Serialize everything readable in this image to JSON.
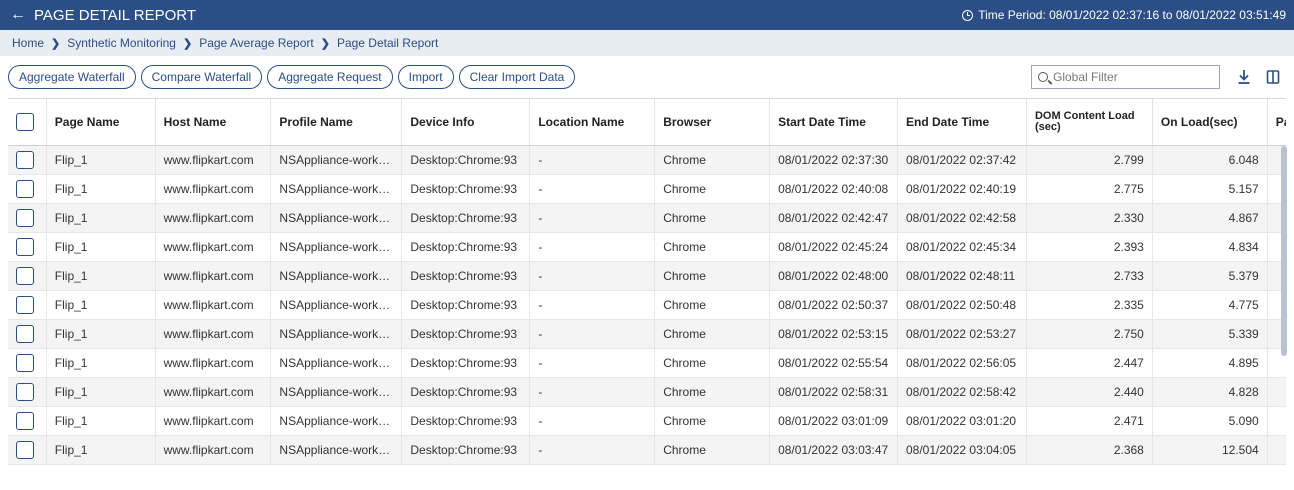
{
  "header": {
    "back_icon": "arrow-left-icon",
    "title": "PAGE DETAIL REPORT",
    "time_icon": "clock-icon",
    "time_period": "Time Period: 08/01/2022 02:37:16 to 08/01/2022 03:51:49"
  },
  "breadcrumb": [
    "Home",
    "Synthetic Monitoring",
    "Page Average Report",
    "Page Detail Report"
  ],
  "toolbar": {
    "buttons": [
      "Aggregate Waterfall",
      "Compare Waterfall",
      "Aggregate Request",
      "Import",
      "Clear Import Data"
    ],
    "filter_placeholder": "Global Filter",
    "download_icon": "download-icon",
    "columns_icon": "columns-icon"
  },
  "table": {
    "columns": [
      "Page Name",
      "Host Name",
      "Profile Name",
      "Device Info",
      "Location Name",
      "Browser",
      "Start Date Time",
      "End Date Time",
      "DOM Content Load (sec)",
      "On Load(sec)",
      "Pag"
    ],
    "rows": [
      [
        "Flip_1",
        "www.flipkart.com",
        "NSAppliance-work-c...",
        "Desktop:Chrome:93",
        "-",
        "Chrome",
        "08/01/2022 02:37:30",
        "08/01/2022 02:37:42",
        "2.799",
        "6.048",
        ""
      ],
      [
        "Flip_1",
        "www.flipkart.com",
        "NSAppliance-work-c...",
        "Desktop:Chrome:93",
        "-",
        "Chrome",
        "08/01/2022 02:40:08",
        "08/01/2022 02:40:19",
        "2.775",
        "5.157",
        ""
      ],
      [
        "Flip_1",
        "www.flipkart.com",
        "NSAppliance-work-c...",
        "Desktop:Chrome:93",
        "-",
        "Chrome",
        "08/01/2022 02:42:47",
        "08/01/2022 02:42:58",
        "2.330",
        "4.867",
        ""
      ],
      [
        "Flip_1",
        "www.flipkart.com",
        "NSAppliance-work-c...",
        "Desktop:Chrome:93",
        "-",
        "Chrome",
        "08/01/2022 02:45:24",
        "08/01/2022 02:45:34",
        "2.393",
        "4.834",
        ""
      ],
      [
        "Flip_1",
        "www.flipkart.com",
        "NSAppliance-work-c...",
        "Desktop:Chrome:93",
        "-",
        "Chrome",
        "08/01/2022 02:48:00",
        "08/01/2022 02:48:11",
        "2.733",
        "5.379",
        ""
      ],
      [
        "Flip_1",
        "www.flipkart.com",
        "NSAppliance-work-c...",
        "Desktop:Chrome:93",
        "-",
        "Chrome",
        "08/01/2022 02:50:37",
        "08/01/2022 02:50:48",
        "2.335",
        "4.775",
        ""
      ],
      [
        "Flip_1",
        "www.flipkart.com",
        "NSAppliance-work-c...",
        "Desktop:Chrome:93",
        "-",
        "Chrome",
        "08/01/2022 02:53:15",
        "08/01/2022 02:53:27",
        "2.750",
        "5.339",
        ""
      ],
      [
        "Flip_1",
        "www.flipkart.com",
        "NSAppliance-work-c...",
        "Desktop:Chrome:93",
        "-",
        "Chrome",
        "08/01/2022 02:55:54",
        "08/01/2022 02:56:05",
        "2.447",
        "4.895",
        ""
      ],
      [
        "Flip_1",
        "www.flipkart.com",
        "NSAppliance-work-c...",
        "Desktop:Chrome:93",
        "-",
        "Chrome",
        "08/01/2022 02:58:31",
        "08/01/2022 02:58:42",
        "2.440",
        "4.828",
        ""
      ],
      [
        "Flip_1",
        "www.flipkart.com",
        "NSAppliance-work-c...",
        "Desktop:Chrome:93",
        "-",
        "Chrome",
        "08/01/2022 03:01:09",
        "08/01/2022 03:01:20",
        "2.471",
        "5.090",
        ""
      ],
      [
        "Flip_1",
        "www.flipkart.com",
        "NSAppliance-work-c...",
        "Desktop:Chrome:93",
        "-",
        "Chrome",
        "08/01/2022 03:03:47",
        "08/01/2022 03:04:05",
        "2.368",
        "12.504",
        ""
      ]
    ]
  },
  "colors": {
    "brand": "#2b4e86",
    "breadcrumb_bg": "#e8edf4",
    "row_alt": "#f4f4f4"
  }
}
